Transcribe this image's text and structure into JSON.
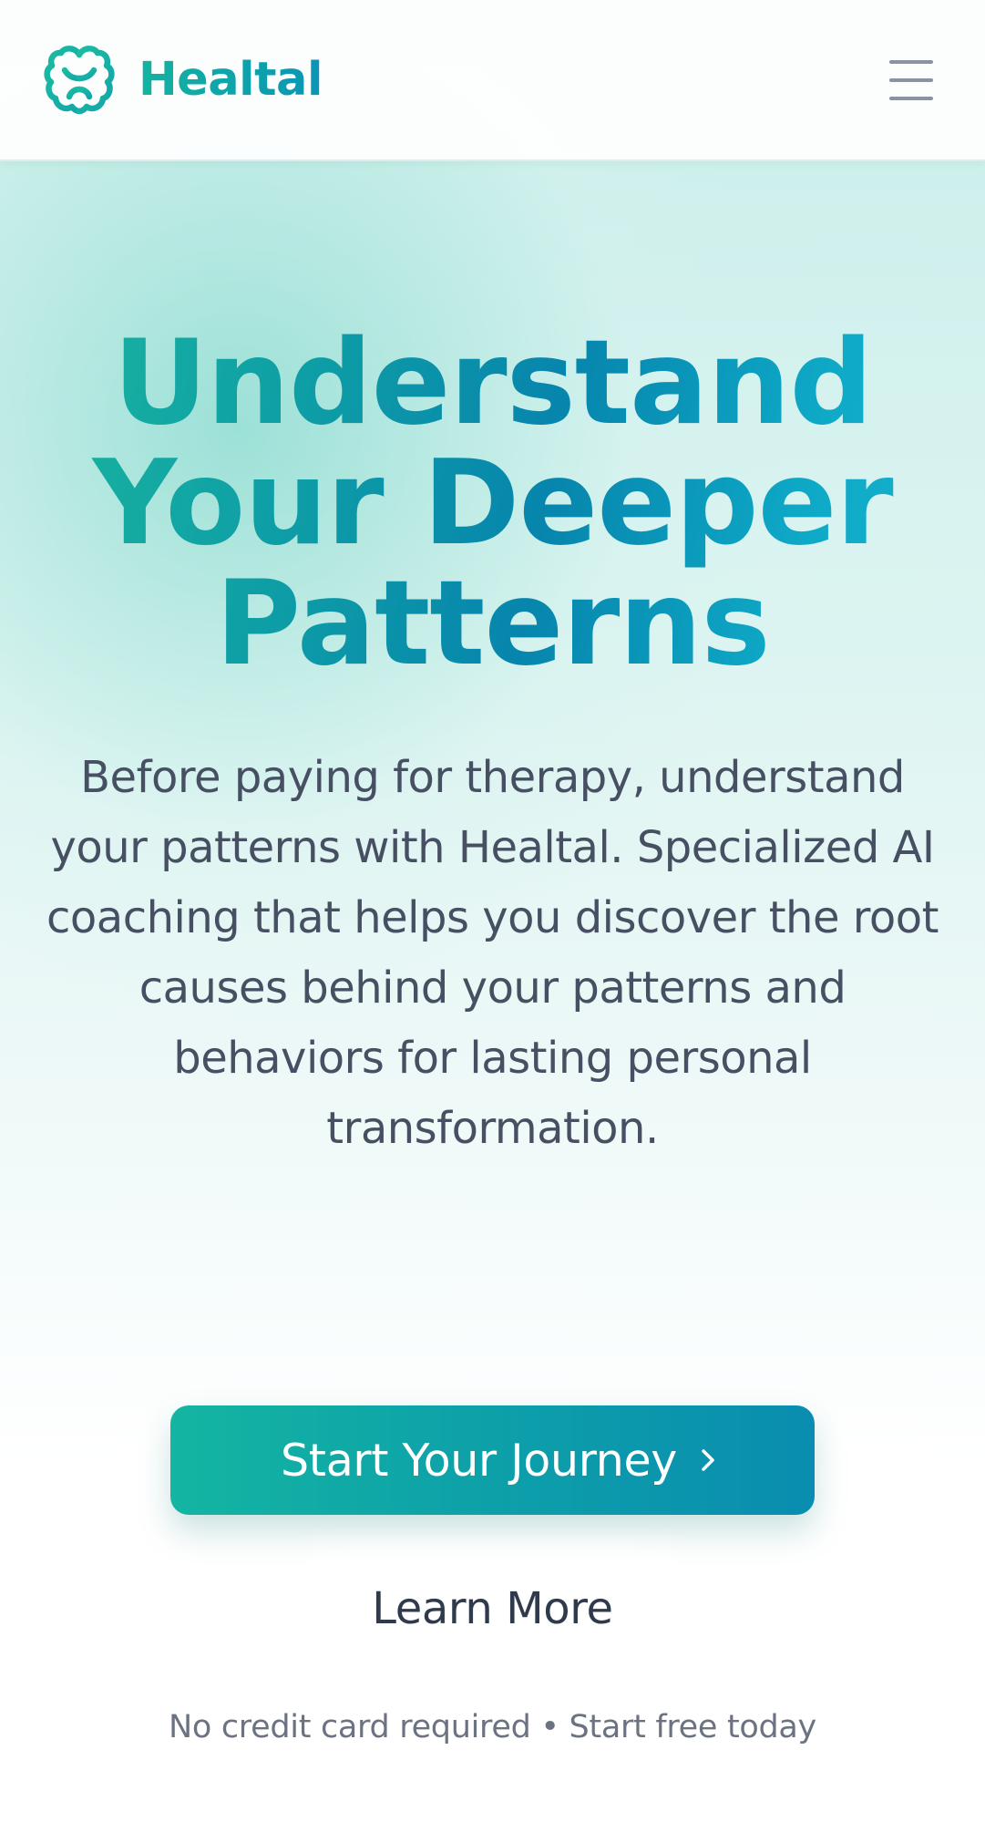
{
  "header": {
    "brand": "Healtal",
    "logo_icon": "brain-icon",
    "menu_icon": "hamburger-menu-icon"
  },
  "hero": {
    "headline_lines": [
      "Understand",
      "Your Deeper",
      "Patterns"
    ],
    "description": "Before paying for therapy, understand your patterns with Healtal. Specialized AI coaching that helps you discover the root causes behind your patterns and behaviors for lasting personal transformation.",
    "primary_cta": {
      "label": "Start Your Journey",
      "icon": "chevron-right-icon"
    },
    "secondary_cta": {
      "label": "Learn More"
    },
    "fineprint": "No credit card required • Start free today"
  },
  "colors": {
    "brand_teal": "#14b3a0",
    "brand_blue": "#0a8db0",
    "text_dark": "#475063",
    "text_muted": "#6b7382"
  }
}
